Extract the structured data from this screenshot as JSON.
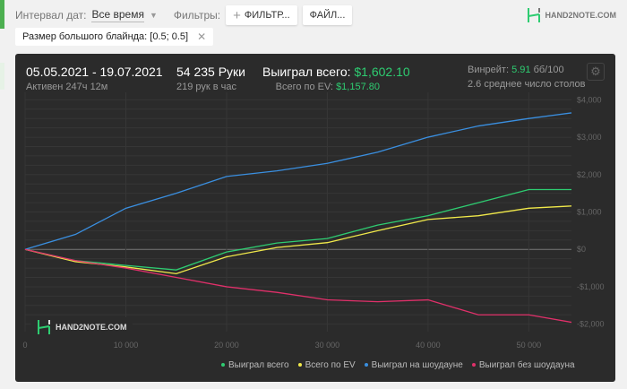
{
  "toolbar": {
    "date_label": "Интервал дат:",
    "date_value": "Все время",
    "filters_label": "Фильтры:",
    "filter_button": "ФИЛЬТР...",
    "file_button": "ФАЙЛ..."
  },
  "brand": {
    "logo_text": "HAND2NOTE.COM"
  },
  "active_filter": "Размер большого блайнда: [0.5; 0.5]",
  "stats": {
    "date_range": "05.05.2021 - 19.07.2021",
    "active": "Активен 247ч 12м",
    "hands": "54 235 Руки",
    "hands_per_hour": "219 рук в час",
    "won_label": "Выиграл всего:",
    "won_value": "$1,602.10",
    "ev_label": "Всего по EV:",
    "ev_value": "$1,157.80",
    "winrate_label": "Винрейт:",
    "winrate_value": "5.91",
    "winrate_unit": "бб/100",
    "tables": "2.6 среднее число столов"
  },
  "colors": {
    "green": "#2ecc71",
    "yellow": "#f1e94a",
    "blue": "#3a8fe0",
    "pink": "#e0306a"
  },
  "chart_data": {
    "type": "line",
    "xlim": [
      0,
      54235
    ],
    "ylim": [
      -2200,
      4200
    ],
    "x_ticks": [
      "0",
      "10 000",
      "20 000",
      "30 000",
      "40 000",
      "50 000"
    ],
    "x_tick_values": [
      0,
      10000,
      20000,
      30000,
      40000,
      50000
    ],
    "y_ticks": [
      "$4,000",
      "$3,000",
      "$2,000",
      "$1,000",
      "$0",
      "-$1,000",
      "-$2,000"
    ],
    "y_tick_values": [
      4000,
      3000,
      2000,
      1000,
      0,
      -1000,
      -2000
    ],
    "grid": true,
    "legend": "bottom-right",
    "x": [
      0,
      5000,
      10000,
      15000,
      20000,
      25000,
      30000,
      35000,
      40000,
      45000,
      50000,
      54235
    ],
    "series": [
      {
        "name": "Выиграл всего",
        "color": "#2ecc71",
        "values": [
          0,
          -300,
          -430,
          -550,
          -70,
          170,
          290,
          650,
          900,
          1250,
          1600,
          1600
        ]
      },
      {
        "name": "Всего по EV",
        "color": "#f1e94a",
        "values": [
          0,
          -330,
          -470,
          -650,
          -200,
          50,
          180,
          500,
          800,
          900,
          1100,
          1160
        ]
      },
      {
        "name": "Выиграл на шоудауне",
        "color": "#3a8fe0",
        "values": [
          0,
          400,
          1100,
          1500,
          1950,
          2100,
          2300,
          2600,
          3000,
          3300,
          3500,
          3650
        ]
      },
      {
        "name": "Выиграл без шоудауна",
        "color": "#e0306a",
        "values": [
          0,
          -300,
          -500,
          -750,
          -1000,
          -1150,
          -1350,
          -1400,
          -1350,
          -1750,
          -1750,
          -1950
        ]
      }
    ]
  }
}
